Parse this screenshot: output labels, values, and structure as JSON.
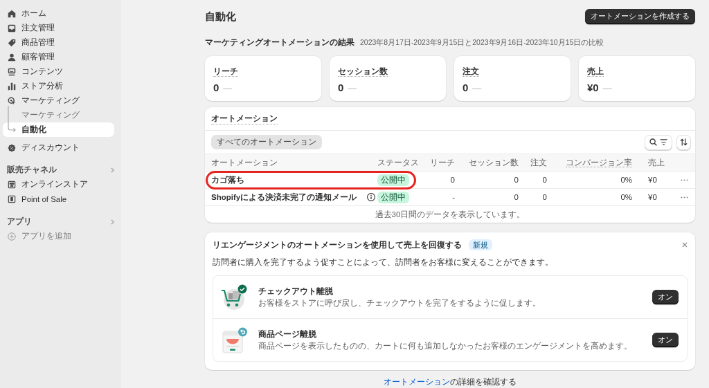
{
  "sidebar": {
    "items": [
      {
        "label": "ホーム",
        "selected": false
      },
      {
        "label": "注文管理",
        "selected": false
      },
      {
        "label": "商品管理",
        "selected": false
      },
      {
        "label": "顧客管理",
        "selected": false
      },
      {
        "label": "コンテンツ",
        "selected": false
      },
      {
        "label": "ストア分析",
        "selected": false
      },
      {
        "label": "マーケティング",
        "selected": false,
        "children": [
          {
            "label": "マーケティング",
            "selected": false
          },
          {
            "label": "自動化",
            "selected": true
          }
        ]
      },
      {
        "label": "ディスカウント",
        "selected": false
      }
    ],
    "sections": [
      {
        "title": "販売チャネル",
        "items": [
          {
            "label": "オンラインストア",
            "kind": "link"
          },
          {
            "label": "Point of Sale",
            "kind": "link"
          }
        ]
      },
      {
        "title": "アプリ",
        "items": [
          {
            "label": "アプリを追加",
            "kind": "add"
          }
        ]
      }
    ]
  },
  "header": {
    "title": "自動化",
    "primary_action": "オートメーションを作成する"
  },
  "results": {
    "title": "マーケティングオートメーションの結果",
    "period": "2023年8月17日-2023年9月15日と2023年9月16日-2023年10月15日の比較",
    "metrics": [
      {
        "label": "リーチ",
        "value": "0",
        "change": "—"
      },
      {
        "label": "セッション数",
        "value": "0",
        "change": "—"
      },
      {
        "label": "注文",
        "value": "0",
        "change": "—"
      },
      {
        "label": "売上",
        "value": "¥0",
        "change": "—"
      }
    ]
  },
  "automations": {
    "title": "オートメーション",
    "filters": [
      {
        "label": "すべてのオートメーション",
        "selected": true
      }
    ],
    "columns": [
      {
        "label": "オートメーション",
        "underlined": false
      },
      {
        "label": "ステータス",
        "underlined": false
      },
      {
        "label": "リーチ",
        "underlined": false
      },
      {
        "label": "セッション数",
        "underlined": false
      },
      {
        "label": "注文",
        "underlined": false
      },
      {
        "label": "コンバージョン率",
        "underlined": true
      },
      {
        "label": "売上",
        "underlined": false
      }
    ],
    "rows": [
      {
        "name": "カゴ落ち",
        "info": false,
        "status": "公開中",
        "reach": "0",
        "sessions": "0",
        "orders": "0",
        "conversion": "0%",
        "sales": "¥0",
        "highlighted": true
      },
      {
        "name": "Shopifyによる決済未完了の通知メール",
        "info": true,
        "status": "公開中",
        "reach": "-",
        "sessions": "0",
        "orders": "0",
        "conversion": "0%",
        "sales": "¥0",
        "highlighted": false
      }
    ],
    "note": "過去30日間のデータを表示しています。"
  },
  "reengagement": {
    "title": "リエンゲージメントのオートメーションを使用して売上を回復する",
    "badge": "新規",
    "description": "訪問者に購入を完了するよう促すことによって、訪問者をお客様に変えることができます。",
    "items": [
      {
        "title": "チェックアウト離脱",
        "description": "お客様をストアに呼び戻し、チェックアウトを完了をするように促します。",
        "action": "オン"
      },
      {
        "title": "商品ページ離脱",
        "description": "商品ページを表示したものの、カートに何も追加しなかったお客様のエンゲージメントを高めます。",
        "action": "オン"
      }
    ]
  },
  "footer": {
    "link": "オートメーション",
    "text": "の詳細を確認する"
  }
}
